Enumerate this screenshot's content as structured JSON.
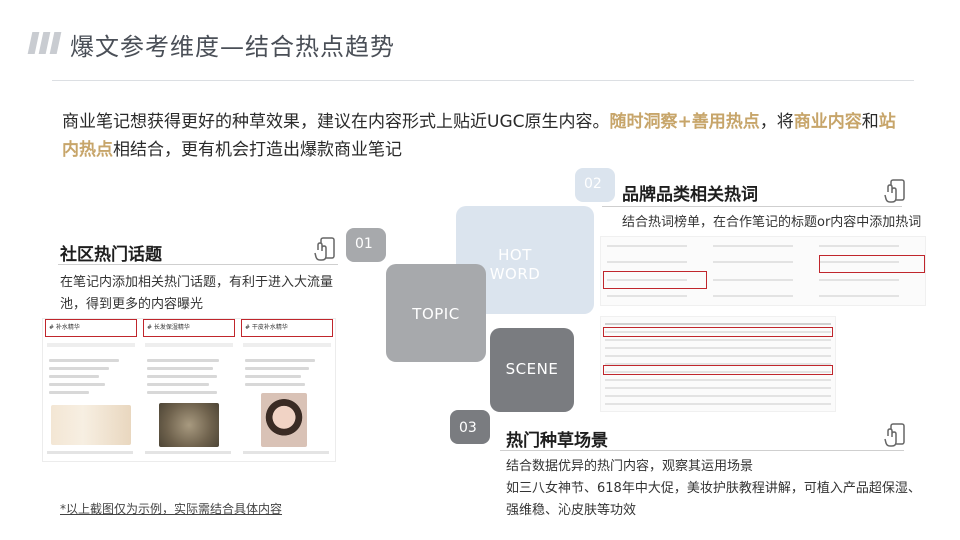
{
  "header": {
    "title": "爆文参考维度—结合热点趋势"
  },
  "intro": {
    "part1": "商业笔记想获得更好的种草效果，建议在内容形式上贴近UGC原生内容。",
    "hl1": "随时洞察+善用热点",
    "part2": "，将",
    "hl2": "商业内容",
    "part3": "和",
    "hl3": "站内热点",
    "part4": "相结合，更有机会打造出爆款商业笔记"
  },
  "sections": {
    "community": {
      "title": "社区热门话题",
      "desc": "在笔记内添加相关热门话题，有利于进入大流量池，得到更多的内容曝光",
      "tags": [
        "# 补水精华",
        "# 长发保湿精华",
        "# 干皮补水精华"
      ]
    },
    "brand": {
      "title": "品牌品类相关热词",
      "desc": "结合热词榜单，在合作笔记的标题or内容中添加热词"
    },
    "scene": {
      "title": "热门种草场景",
      "desc_line1": "结合数据优异的热门内容，观察其运用场景",
      "desc_line2": "如三八女神节、618年中大促，美妆护肤教程讲解，可植入产品超保湿、",
      "desc_line3": "强维稳、沁皮肤等功效"
    }
  },
  "diagram": {
    "num1": "01",
    "num2": "02",
    "num3": "03",
    "label_topic": "TOPIC",
    "label_hot1": "HOT",
    "label_hot2": "WORD",
    "label_scene": "SCENE"
  },
  "footnote": "*以上截图仅为示例，实际需结合具体内容",
  "colors": {
    "highlight": "#c7a56a",
    "topic_gray": "#a7a9ac",
    "hot_blue": "#dbe4ee",
    "scene_dark": "#7a7c80",
    "red_box": "#c0262c"
  },
  "icons": [
    "tap-hand-icon",
    "tap-hand-icon",
    "tap-hand-icon"
  ]
}
